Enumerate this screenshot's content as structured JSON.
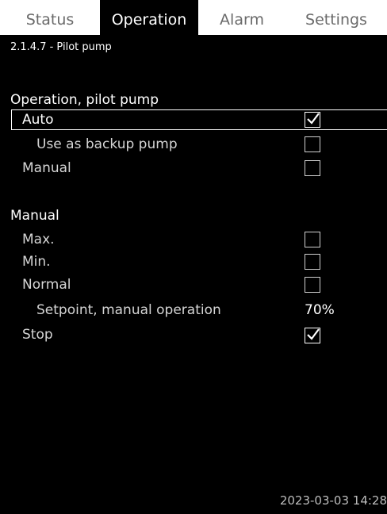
{
  "tabs": [
    {
      "label": "Status",
      "active": false
    },
    {
      "label": "Operation",
      "active": true
    },
    {
      "label": "Alarm",
      "active": false
    },
    {
      "label": "Settings",
      "active": false
    }
  ],
  "page_id": "2.1.4.7 - Pilot pump",
  "section_operation": {
    "heading": "Operation, pilot pump",
    "auto": {
      "label": "Auto",
      "checked": true
    },
    "backup": {
      "label": "Use as backup pump",
      "checked": false
    },
    "manual": {
      "label": "Manual",
      "checked": false
    }
  },
  "section_manual": {
    "heading": "Manual",
    "max": {
      "label": "Max.",
      "checked": false
    },
    "min": {
      "label": "Min.",
      "checked": false
    },
    "normal": {
      "label": "Normal",
      "checked": false
    },
    "setpoint": {
      "label": "Setpoint, manual operation",
      "value": "70%"
    },
    "stop": {
      "label": "Stop",
      "checked": true
    }
  },
  "timestamp": "2023-03-03 14:28"
}
